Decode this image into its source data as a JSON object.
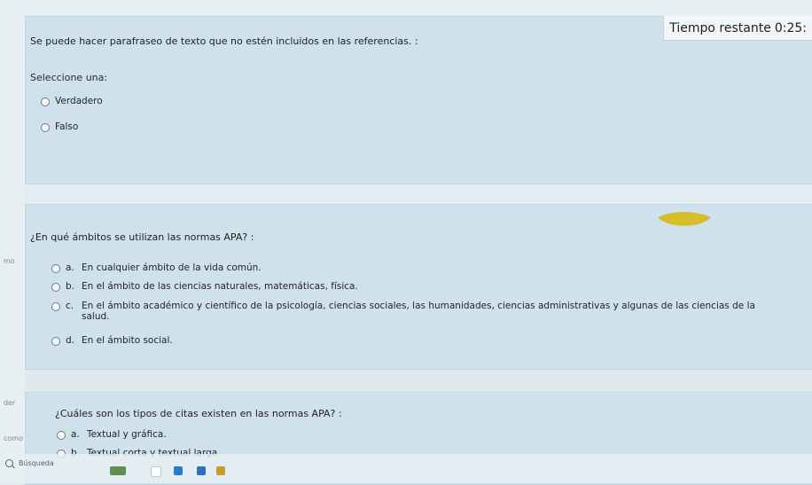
{
  "timer": {
    "label": "Tiempo restante",
    "value": "0:25:"
  },
  "questions": [
    {
      "text": "Se puede hacer parafraseo de texto que no estén incluidos en las referencias. :",
      "prompt": "Seleccione una:",
      "options": [
        {
          "letter": "",
          "text": "Verdadero"
        },
        {
          "letter": "",
          "text": "Falso"
        }
      ]
    },
    {
      "text": "¿En qué ámbitos se utilizan las normas APA? :",
      "options": [
        {
          "letter": "a.",
          "text": "En cualquier ámbito de la vida común."
        },
        {
          "letter": "b.",
          "text": "En el ámbito de las ciencias naturales, matemáticas, física."
        },
        {
          "letter": "c.",
          "text": "En el ámbito académico y científico de la psicología, ciencias sociales, las humanidades, ciencias administrativas y algunas de las ciencias de la salud."
        },
        {
          "letter": "d.",
          "text": "En el ámbito social."
        }
      ]
    },
    {
      "text": "¿Cuáles son los tipos de citas existen en las normas APA? :",
      "options": [
        {
          "letter": "a.",
          "text": "Textual y gráfica."
        },
        {
          "letter": "b.",
          "text": "Textual corta y textual larga"
        }
      ]
    }
  ],
  "sidebar_fragments": {
    "f1": "mo",
    "f2": "der",
    "f3": "como"
  },
  "taskbar": {
    "search_label": "Búsqueda"
  },
  "colors": {
    "card_background": "#cfe1ea",
    "page_background": "#dfe9ee",
    "timer_background": "#f2f6f8",
    "accent_yellow": "#d7bd2b"
  }
}
